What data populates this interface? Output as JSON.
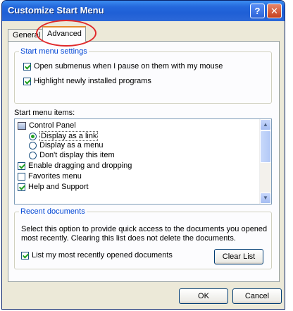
{
  "window": {
    "title": "Customize Start Menu",
    "help_glyph": "?",
    "close_glyph": "✕"
  },
  "tabs": [
    {
      "label": "General"
    },
    {
      "label": "Advanced"
    }
  ],
  "settings_group": {
    "title": "Start menu settings",
    "options": [
      {
        "label": "Open submenus when I pause on them with my mouse",
        "checked": true
      },
      {
        "label": "Highlight newly installed programs",
        "checked": true
      }
    ]
  },
  "items_list": {
    "label": "Start menu items:",
    "control_panel": "Control Panel",
    "cp_options": [
      {
        "label": "Display as a link",
        "selected": true
      },
      {
        "label": "Display as a menu",
        "selected": false
      },
      {
        "label": "Don't display this item",
        "selected": false
      }
    ],
    "checkboxes": [
      {
        "label": "Enable dragging and dropping",
        "checked": true
      },
      {
        "label": "Favorites menu",
        "checked": false
      },
      {
        "label": "Help and Support",
        "checked": true
      }
    ]
  },
  "recent": {
    "title": "Recent documents",
    "description": "Select this option to provide quick access to the documents you opened most recently. Clearing this list does not delete the documents.",
    "list_label": "List my most recently opened documents",
    "list_checked": true,
    "clear_button": "Clear List"
  },
  "buttons": {
    "ok": "OK",
    "cancel": "Cancel"
  },
  "colors": {
    "title_bar": "#2468dc",
    "group_title": "#0046d5",
    "annotation_circle": "#e0282a"
  }
}
